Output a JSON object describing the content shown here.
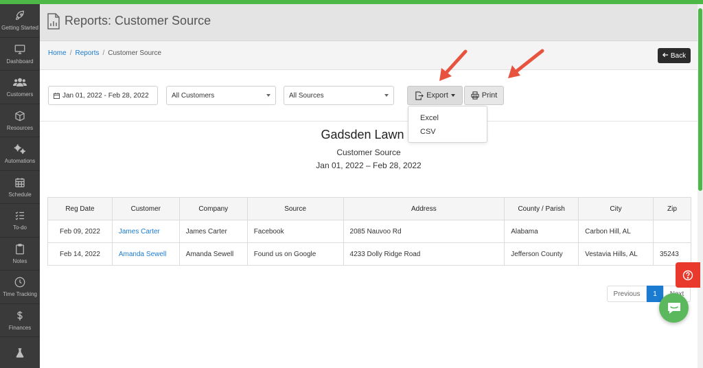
{
  "page": {
    "title": "Reports: Customer Source"
  },
  "sidebar": {
    "items": [
      {
        "label": "Getting Started",
        "icon": "rocket-icon"
      },
      {
        "label": "Dashboard",
        "icon": "monitor-icon"
      },
      {
        "label": "Customers",
        "icon": "users-icon"
      },
      {
        "label": "Resources",
        "icon": "box-icon"
      },
      {
        "label": "Automations",
        "icon": "gears-icon"
      },
      {
        "label": "Schedule",
        "icon": "calendar-icon"
      },
      {
        "label": "To-do",
        "icon": "checklist-icon"
      },
      {
        "label": "Notes",
        "icon": "clipboard-icon"
      },
      {
        "label": "Time Tracking",
        "icon": "clock-icon"
      },
      {
        "label": "Finances",
        "icon": "dollar-icon"
      },
      {
        "label": "",
        "icon": "flask-icon"
      }
    ]
  },
  "breadcrumb": {
    "home": "Home",
    "reports": "Reports",
    "current": "Customer Source",
    "separator": "/"
  },
  "back_button": {
    "label": "Back"
  },
  "filters": {
    "date_range": "Jan 01, 2022 - Feb 28, 2022",
    "customers": "All Customers",
    "sources": "All Sources"
  },
  "export": {
    "label": "Export",
    "options": [
      "Excel",
      "CSV"
    ]
  },
  "print": {
    "label": "Print"
  },
  "report": {
    "company": "Gadsden Lawn C",
    "subtitle": "Customer Source",
    "range": "Jan 01, 2022 – Feb 28, 2022"
  },
  "table": {
    "headers": [
      "Reg Date",
      "Customer",
      "Company",
      "Source",
      "Address",
      "County / Parish",
      "City",
      "Zip"
    ],
    "rows": [
      [
        "Feb 09, 2022",
        "James Carter",
        "James Carter",
        "Facebook",
        "2085 Nauvoo Rd",
        "Alabama",
        "Carbon Hill, AL",
        ""
      ],
      [
        "Feb 14, 2022",
        "Amanda Sewell",
        "Amanda Sewell",
        "Found us on Google",
        "4233 Dolly Ridge Road",
        "Jefferson County",
        "Vestavia Hills, AL",
        "35243"
      ]
    ]
  },
  "pagination": {
    "previous": "Previous",
    "current": "1",
    "next": "Next"
  },
  "colors": {
    "accent_green": "#4db848",
    "link_blue": "#1a7bd0",
    "sidebar_bg": "#3a3a3a",
    "annotation_arrow": "#e8533f",
    "help_red": "#e8392c"
  }
}
